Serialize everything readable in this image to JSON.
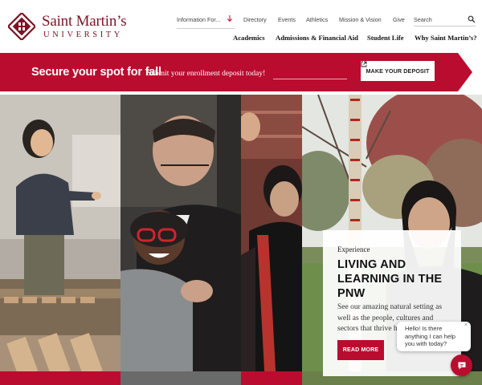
{
  "brand": {
    "name": "Saint Martin’s",
    "subtitle": "UNIVERSITY",
    "color": "#7a1523",
    "accent": "#ba0c2f"
  },
  "utility_nav": {
    "info_dropdown": "Information For...",
    "links": [
      "Directory",
      "Events",
      "Athletics",
      "Mission & Vision",
      "Give"
    ],
    "search_placeholder": "Search"
  },
  "main_nav": [
    "Academics",
    "Admissions & Financial Aid",
    "Student Life",
    "Why Saint Martin’s?"
  ],
  "banner": {
    "title": "Secure your spot for fall",
    "subtitle": "Submit your enrollment deposit today!",
    "button": "MAKE YOUR DEPOSIT",
    "button_icon": "external-link-icon"
  },
  "hero_card": {
    "eyebrow": "Experience",
    "title": "LIVING AND LEARNING IN THE PNW",
    "description": "See our amazing natural setting as well as the people, cultures and sectors that thrive h",
    "button": "READ MORE"
  },
  "chat": {
    "message": "Hello! Is there anything I can help you with today?",
    "close": "×",
    "icon": "chat-icon"
  }
}
